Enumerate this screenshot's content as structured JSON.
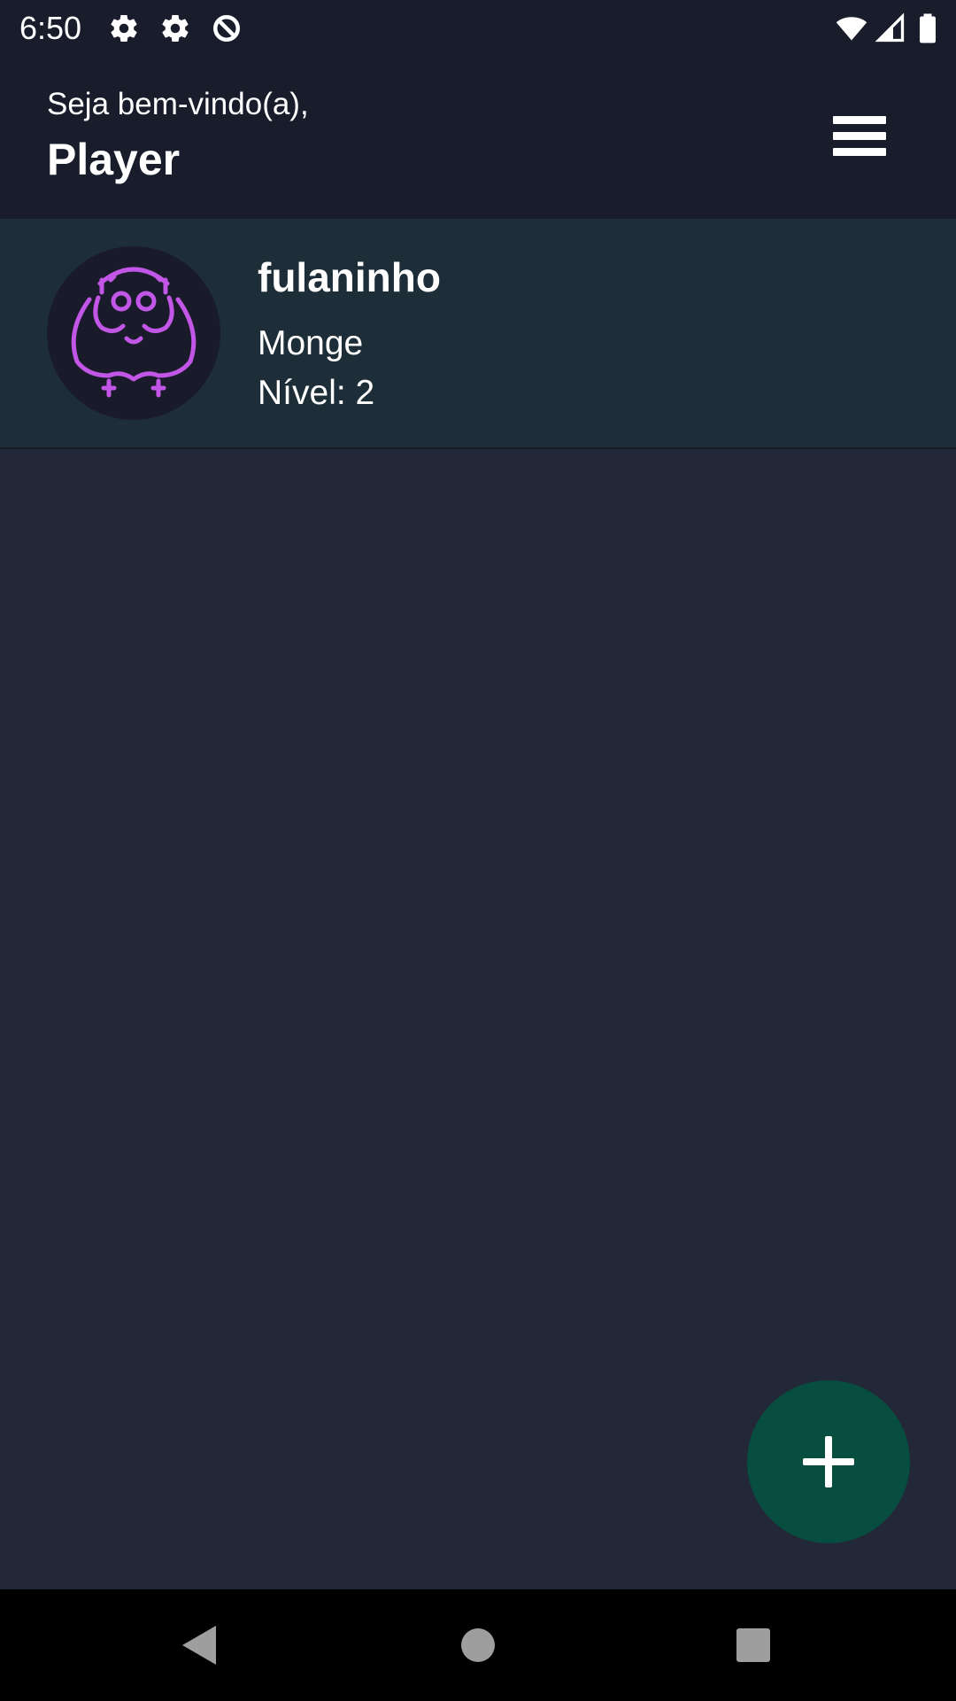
{
  "status_bar": {
    "time": "6:50",
    "icons": [
      "settings-icon",
      "settings-icon",
      "data-saver-icon",
      "wifi-icon",
      "cell-signal-icon",
      "battery-icon"
    ]
  },
  "header": {
    "greeting": "Seja bem-vindo(a),",
    "player_name": "Player",
    "menu_icon": "hamburger-menu-icon"
  },
  "characters": [
    {
      "name": "fulaninho",
      "class": "Monge",
      "level": "Nível: 2",
      "avatar_icon": "monk-class-icon"
    }
  ],
  "fab": {
    "icon": "plus-icon"
  },
  "nav_bar": {
    "icons": [
      "back-icon",
      "home-icon",
      "recents-icon"
    ]
  },
  "colors": {
    "background": "#222837",
    "header": "#191d2b",
    "card": "#1e2e38",
    "avatar_accent": "#c256e6",
    "fab": "#074d40"
  }
}
